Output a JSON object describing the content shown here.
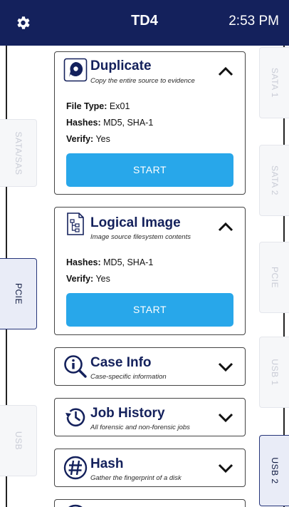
{
  "header": {
    "title": "TD4",
    "time": "2:53 PM",
    "settings_icon": "gear-icon"
  },
  "left_tabs": [
    {
      "label": "SATA/SAS",
      "active": false
    },
    {
      "label": "PCIE",
      "active": true
    },
    {
      "label": "USB",
      "active": false
    }
  ],
  "right_tabs": [
    {
      "label": "SATA 1",
      "active": false
    },
    {
      "label": "SATA 2",
      "active": false
    },
    {
      "label": "PCIE",
      "active": false
    },
    {
      "label": "USB 1",
      "active": false
    },
    {
      "label": "USB 2",
      "active": true
    }
  ],
  "cards": {
    "duplicate": {
      "title": "Duplicate",
      "subtitle": "Copy the entire source to evidence",
      "icon": "disk-icon",
      "expanded": true,
      "details": [
        {
          "key": "File Type:",
          "value": "Ex01"
        },
        {
          "key": "Hashes:",
          "value": "MD5, SHA-1"
        },
        {
          "key": "Verify:",
          "value": "Yes"
        }
      ],
      "button_label": "START"
    },
    "logical_image": {
      "title": "Logical Image",
      "subtitle": "Image source filesystem contents",
      "icon": "file-tree-icon",
      "expanded": true,
      "details": [
        {
          "key": "Hashes:",
          "value": "MD5, SHA-1"
        },
        {
          "key": "Verify:",
          "value": "Yes"
        }
      ],
      "button_label": "START"
    },
    "case_info": {
      "title": "Case Info",
      "subtitle": "Case-specific information",
      "icon": "info-magnifier-icon",
      "expanded": false
    },
    "job_history": {
      "title": "Job History",
      "subtitle": "All forensic and non-forensic jobs",
      "icon": "history-icon",
      "expanded": false
    },
    "hash": {
      "title": "Hash",
      "subtitle": "Gather the fingerprint of a disk",
      "icon": "hash-icon",
      "expanded": false
    }
  },
  "colors": {
    "header_bg": "#14215c",
    "title_text": "#14215c",
    "start_button": "#28a7ea"
  }
}
